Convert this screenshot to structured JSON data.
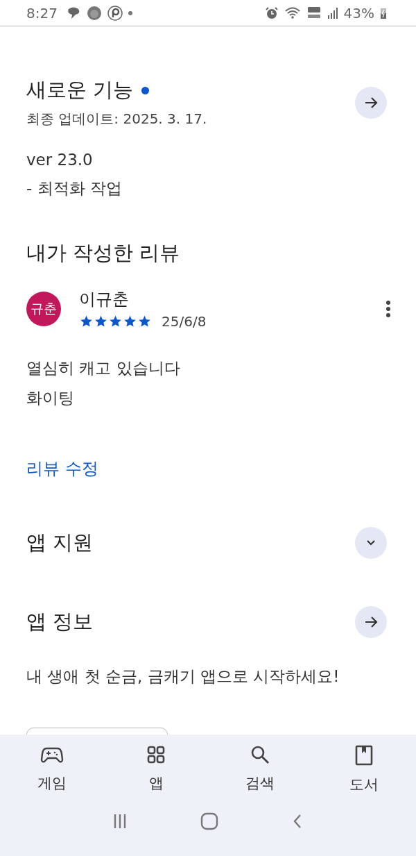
{
  "status_bar": {
    "time": "8:27",
    "battery": "43%"
  },
  "whats_new": {
    "title": "새로운 기능",
    "new": true,
    "updated": "최종 업데이트: 2025. 3. 17.",
    "notes": [
      "ver 23.0",
      "- 최적화 작업"
    ]
  },
  "my_review": {
    "heading": "내가 작성한 리뷰",
    "avatar": "규춘",
    "author": "이규춘",
    "stars": 5,
    "date": "25/6/8",
    "text": [
      "열심히 캐고 있습니다",
      "화이팅"
    ],
    "edit_link": "리뷰 수정"
  },
  "sections": [
    {
      "title": "앱 지원",
      "kind": "expand"
    },
    {
      "title": "앱 정보",
      "kind": "arrow",
      "description": "내 생애 첫 순금, 금캐기 앱으로 시작하세요!"
    }
  ],
  "bottom_nav": [
    {
      "label": "게임",
      "kind": "games"
    },
    {
      "label": "앱",
      "kind": "apps"
    },
    {
      "label": "검색",
      "kind": "search"
    },
    {
      "label": "도서",
      "kind": "books"
    }
  ]
}
